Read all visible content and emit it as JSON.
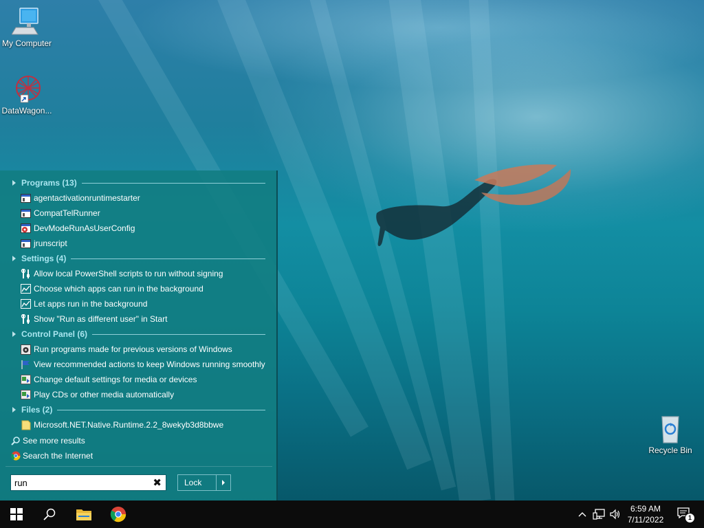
{
  "desktop": {
    "icons": [
      {
        "label": "My Computer",
        "icon": "computer-icon"
      },
      {
        "label": "DataWagon...",
        "icon": "datawagon-shortcut-icon"
      },
      {
        "label": "Recycle Bin",
        "icon": "recycle-bin-icon"
      }
    ]
  },
  "start_menu": {
    "groups": [
      {
        "header": "Programs (13)",
        "items": [
          {
            "label": "agentactivationruntimestarter",
            "icon": "app-window-icon"
          },
          {
            "label": "CompatTelRunner",
            "icon": "app-window-icon"
          },
          {
            "label": "DevModeRunAsUserConfig",
            "icon": "devmode-icon"
          },
          {
            "label": "jrunscript",
            "icon": "app-window-icon"
          }
        ]
      },
      {
        "header": "Settings (4)",
        "items": [
          {
            "label": "Allow local PowerShell scripts to run without signing",
            "icon": "tools-icon"
          },
          {
            "label": "Choose which apps can run in the background",
            "icon": "chart-icon"
          },
          {
            "label": "Let apps run in the background",
            "icon": "chart-icon"
          },
          {
            "label": "Show \"Run as different user\" in Start",
            "icon": "tools-icon"
          }
        ]
      },
      {
        "header": "Control Panel (6)",
        "items": [
          {
            "label": "Run programs made for previous versions of Windows",
            "icon": "compatibility-icon"
          },
          {
            "label": "View recommended actions to keep Windows running smoothly",
            "icon": "flag-icon"
          },
          {
            "label": "Change default settings for media or devices",
            "icon": "autoplay-icon"
          },
          {
            "label": "Play CDs or other media automatically",
            "icon": "autoplay-icon"
          }
        ]
      },
      {
        "header": "Files (2)",
        "items": [
          {
            "label": "Microsoft.NET.Native.Runtime.2.2_8wekyb3d8bbwe",
            "icon": "folder-icon"
          }
        ]
      }
    ],
    "see_more": "See more results",
    "search_internet": "Search the Internet",
    "search_value": "run",
    "clear_glyph": "✖",
    "lock_label": "Lock"
  },
  "taskbar": {
    "time": "6:59 AM",
    "date": "7/11/2022",
    "notification_count": "1"
  }
}
